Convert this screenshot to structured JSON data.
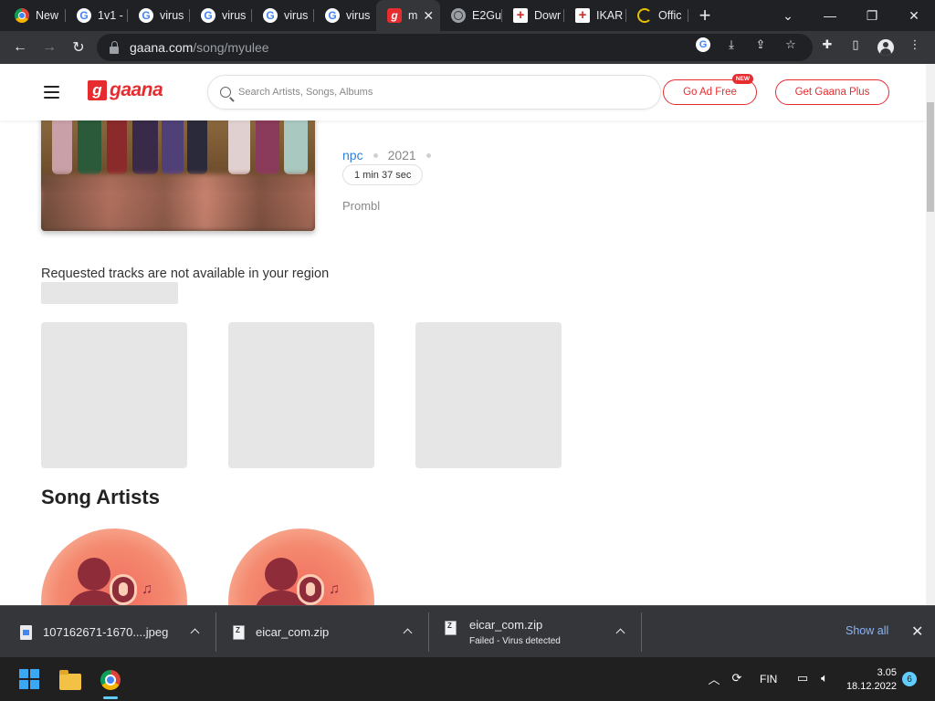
{
  "browser": {
    "tabs": [
      {
        "title": "New",
        "icon": "chrome-icon"
      },
      {
        "title": "1v1 -",
        "icon": "google-icon"
      },
      {
        "title": "virus",
        "icon": "google-icon"
      },
      {
        "title": "virus",
        "icon": "google-icon"
      },
      {
        "title": "virus",
        "icon": "google-icon"
      },
      {
        "title": "virus",
        "icon": "google-icon"
      },
      {
        "title": "m",
        "icon": "gaana-icon",
        "active": true
      },
      {
        "title": "E2Gu",
        "icon": "globe-icon"
      },
      {
        "title": "Dowr",
        "icon": "cross-icon"
      },
      {
        "title": "IKAR",
        "icon": "cross-icon"
      },
      {
        "title": "Offic",
        "icon": "loading-icon"
      }
    ],
    "url_host": "gaana.com",
    "url_path": "/song/myulee"
  },
  "gaana": {
    "logo_letter": "g",
    "logo_text": "gaana",
    "search_placeholder": "Search Artists, Songs, Albums",
    "go_ad_free": "Go Ad Free",
    "new_badge": "NEW",
    "get_plus": "Get Gaana Plus",
    "song": {
      "artist": "npc",
      "year": "2021",
      "duration": "1 min 37 sec",
      "label": "Prombl"
    },
    "region_message": "Requested tracks are not available in your region",
    "section_artists": "Song Artists"
  },
  "downloads": {
    "items": [
      {
        "name": "107162671-1670....jpeg",
        "status": ""
      },
      {
        "name": "eicar_com.zip",
        "status": ""
      },
      {
        "name": "eicar_com.zip",
        "status": "Failed - Virus detected"
      }
    ],
    "show_all": "Show all"
  },
  "taskbar": {
    "language": "FIN",
    "time": "3.05",
    "date": "18.12.2022",
    "notifications": "6"
  },
  "colors": {
    "brand": "#e72c30",
    "link": "#2f80d8",
    "chrome_dark": "#35363a"
  }
}
